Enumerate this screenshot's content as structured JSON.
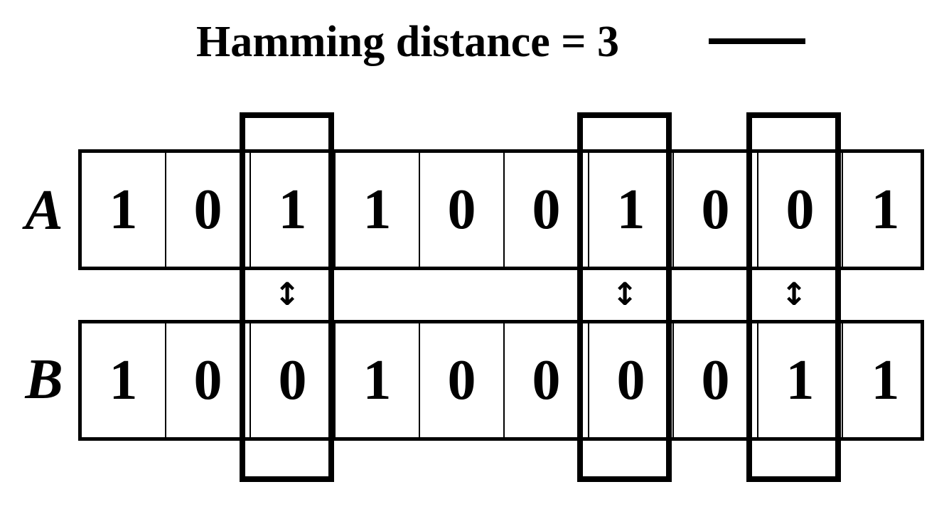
{
  "title": "Hamming distance = 3",
  "rows": [
    {
      "label": "A",
      "bits": [
        "1",
        "0",
        "1",
        "1",
        "0",
        "0",
        "1",
        "0",
        "0",
        "1"
      ]
    },
    {
      "label": "B",
      "bits": [
        "1",
        "0",
        "0",
        "1",
        "0",
        "0",
        "0",
        "0",
        "1",
        "1"
      ]
    }
  ],
  "difference_positions": [
    3,
    7,
    9
  ],
  "arrow_symbol": "↕",
  "colors": {
    "stroke": "#000000",
    "background": "#ffffff"
  }
}
